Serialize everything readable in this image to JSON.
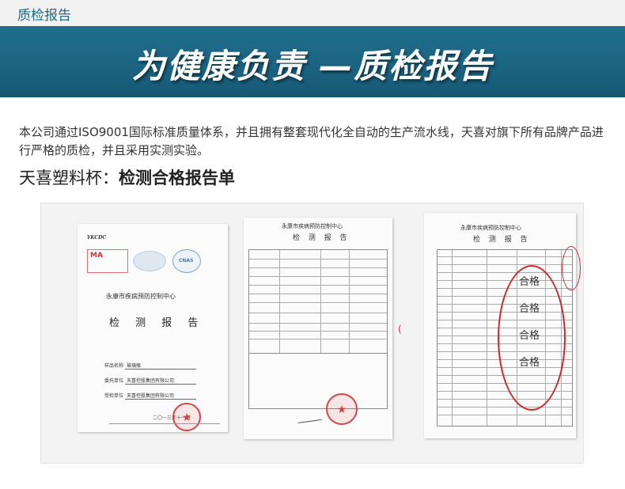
{
  "section_label": "质检报告",
  "banner_title": "为健康负责 —质检报告",
  "intro_text": "本公司通过ISO9001国际标准质量体系，并且拥有整套现代化全自动的生产流水线，天喜对旗下所有品牌产品进行严格的质检，并且采用实测实验。",
  "subtitle_prefix": "天喜塑料杯：",
  "subtitle_strong": "检测合格报告单",
  "colors": {
    "banner": "#1b6482",
    "section_label": "#1f6b86",
    "stamp": "#d64545",
    "oval": "#cc2a2a"
  },
  "doc1": {
    "brand": "YKCDC",
    "ma_mark": "MA",
    "cnas_mark": "CNAS",
    "org": "永康市疾病预防控制中心",
    "heading": "检 测 报 告",
    "fields": [
      {
        "k": "样品名称",
        "v": "玻璃瓶"
      },
      {
        "k": "委托单位",
        "v": "天喜控股集团有限公司"
      },
      {
        "k": "受检单位",
        "v": "天喜控股集团有限公司"
      }
    ],
    "date": "二〇一三年十一月"
  },
  "doc2": {
    "org": "永康市疾病预防控制中心",
    "heading": "检 测 报 告"
  },
  "doc3": {
    "org": "永康市疾病预防控制中心",
    "heading": "检 测 报 告",
    "pass_label": "合格",
    "pass_labels": [
      "合格",
      "合格",
      "合格",
      "合格"
    ]
  }
}
